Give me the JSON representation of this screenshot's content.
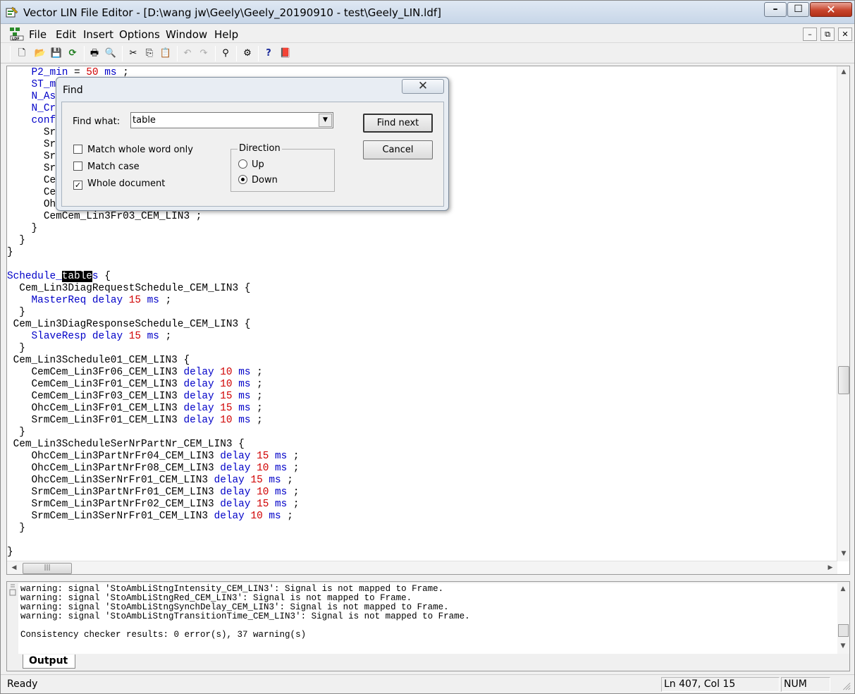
{
  "window": {
    "title": "Vector LIN File Editor - [D:\\wang jw\\Geely\\Geely_20190910 - test\\Geely_LIN.ldf]",
    "min": "–",
    "max": "☐",
    "close": "✕"
  },
  "menu": {
    "file": "File",
    "edit": "Edit",
    "insert": "Insert",
    "options": "Options",
    "window": "Window",
    "help": "Help",
    "mdi_min": "–",
    "mdi_restore": "⧉",
    "mdi_close": "✕"
  },
  "toolbar": {
    "new": "🗋",
    "open": "📂",
    "save": "💾",
    "refresh": "⟳",
    "print": "🖶",
    "preview": "🔍",
    "cut": "✂",
    "copy": "⎘",
    "paste": "📋",
    "undo": "↶",
    "redo": "↷",
    "find": "⚲",
    "check": "⚙",
    "help": "?",
    "book": "📕"
  },
  "editor": {
    "lines": [
      {
        "segs": [
          {
            "t": "    "
          },
          {
            "t": "P2_min",
            "c": "b"
          },
          {
            "t": " = "
          },
          {
            "t": "50",
            "c": "r"
          },
          {
            "t": " "
          },
          {
            "t": "ms",
            "c": "b"
          },
          {
            "t": " ;"
          }
        ]
      },
      {
        "segs": [
          {
            "t": "    "
          },
          {
            "t": "ST_m",
            "c": "b"
          }
        ]
      },
      {
        "segs": [
          {
            "t": "    "
          },
          {
            "t": "N_As",
            "c": "b"
          }
        ]
      },
      {
        "segs": [
          {
            "t": "    "
          },
          {
            "t": "N_Cr",
            "c": "b"
          }
        ]
      },
      {
        "segs": [
          {
            "t": "    "
          },
          {
            "t": "conf",
            "c": "b"
          }
        ]
      },
      {
        "segs": [
          {
            "t": "      Sr"
          }
        ]
      },
      {
        "segs": [
          {
            "t": "      Sr"
          }
        ]
      },
      {
        "segs": [
          {
            "t": "      Sr"
          }
        ]
      },
      {
        "segs": [
          {
            "t": "      Sr"
          }
        ]
      },
      {
        "segs": [
          {
            "t": "      Ce"
          }
        ]
      },
      {
        "segs": [
          {
            "t": "      Ce"
          }
        ]
      },
      {
        "segs": [
          {
            "t": "      Oh"
          }
        ]
      },
      {
        "segs": [
          {
            "t": "      CemCem_Lin3Fr03_CEM_LIN3 ;"
          }
        ]
      },
      {
        "segs": [
          {
            "t": "    }"
          }
        ]
      },
      {
        "segs": [
          {
            "t": "  }"
          }
        ]
      },
      {
        "segs": [
          {
            "t": "}"
          }
        ]
      },
      {
        "segs": [
          {
            "t": ""
          }
        ]
      },
      {
        "segs": [
          {
            "t": "Schedule_",
            "c": "b"
          },
          {
            "t": "table",
            "c": "hl"
          },
          {
            "t": "s",
            "c": "b"
          },
          {
            "t": " {"
          }
        ]
      },
      {
        "segs": [
          {
            "t": "  Cem_Lin3DiagRequestSchedule_CEM_LIN3 {"
          }
        ]
      },
      {
        "segs": [
          {
            "t": "    "
          },
          {
            "t": "MasterReq",
            "c": "b"
          },
          {
            "t": " "
          },
          {
            "t": "delay",
            "c": "b"
          },
          {
            "t": " "
          },
          {
            "t": "15",
            "c": "r"
          },
          {
            "t": " "
          },
          {
            "t": "ms",
            "c": "b"
          },
          {
            "t": " ;"
          }
        ]
      },
      {
        "segs": [
          {
            "t": "  }"
          }
        ]
      },
      {
        "segs": [
          {
            "t": " Cem_Lin3DiagResponseSchedule_CEM_LIN3 {"
          }
        ]
      },
      {
        "segs": [
          {
            "t": "    "
          },
          {
            "t": "SlaveResp",
            "c": "b"
          },
          {
            "t": " "
          },
          {
            "t": "delay",
            "c": "b"
          },
          {
            "t": " "
          },
          {
            "t": "15",
            "c": "r"
          },
          {
            "t": " "
          },
          {
            "t": "ms",
            "c": "b"
          },
          {
            "t": " ;"
          }
        ]
      },
      {
        "segs": [
          {
            "t": "  }"
          }
        ]
      },
      {
        "segs": [
          {
            "t": " Cem_Lin3Schedule01_CEM_LIN3 {"
          }
        ]
      },
      {
        "segs": [
          {
            "t": "    CemCem_Lin3Fr06_CEM_LIN3 "
          },
          {
            "t": "delay",
            "c": "b"
          },
          {
            "t": " "
          },
          {
            "t": "10",
            "c": "r"
          },
          {
            "t": " "
          },
          {
            "t": "ms",
            "c": "b"
          },
          {
            "t": " ;"
          }
        ]
      },
      {
        "segs": [
          {
            "t": "    CemCem_Lin3Fr01_CEM_LIN3 "
          },
          {
            "t": "delay",
            "c": "b"
          },
          {
            "t": " "
          },
          {
            "t": "10",
            "c": "r"
          },
          {
            "t": " "
          },
          {
            "t": "ms",
            "c": "b"
          },
          {
            "t": " ;"
          }
        ]
      },
      {
        "segs": [
          {
            "t": "    CemCem_Lin3Fr03_CEM_LIN3 "
          },
          {
            "t": "delay",
            "c": "b"
          },
          {
            "t": " "
          },
          {
            "t": "15",
            "c": "r"
          },
          {
            "t": " "
          },
          {
            "t": "ms",
            "c": "b"
          },
          {
            "t": " ;"
          }
        ]
      },
      {
        "segs": [
          {
            "t": "    OhcCem_Lin3Fr01_CEM_LIN3 "
          },
          {
            "t": "delay",
            "c": "b"
          },
          {
            "t": " "
          },
          {
            "t": "15",
            "c": "r"
          },
          {
            "t": " "
          },
          {
            "t": "ms",
            "c": "b"
          },
          {
            "t": " ;"
          }
        ]
      },
      {
        "segs": [
          {
            "t": "    SrmCem_Lin3Fr01_CEM_LIN3 "
          },
          {
            "t": "delay",
            "c": "b"
          },
          {
            "t": " "
          },
          {
            "t": "10",
            "c": "r"
          },
          {
            "t": " "
          },
          {
            "t": "ms",
            "c": "b"
          },
          {
            "t": " ;"
          }
        ]
      },
      {
        "segs": [
          {
            "t": "  }"
          }
        ]
      },
      {
        "segs": [
          {
            "t": " Cem_Lin3ScheduleSerNrPartNr_CEM_LIN3 {"
          }
        ]
      },
      {
        "segs": [
          {
            "t": "    OhcCem_Lin3PartNrFr04_CEM_LIN3 "
          },
          {
            "t": "delay",
            "c": "b"
          },
          {
            "t": " "
          },
          {
            "t": "15",
            "c": "r"
          },
          {
            "t": " "
          },
          {
            "t": "ms",
            "c": "b"
          },
          {
            "t": " ;"
          }
        ]
      },
      {
        "segs": [
          {
            "t": "    OhcCem_Lin3PartNrFr08_CEM_LIN3 "
          },
          {
            "t": "delay",
            "c": "b"
          },
          {
            "t": " "
          },
          {
            "t": "10",
            "c": "r"
          },
          {
            "t": " "
          },
          {
            "t": "ms",
            "c": "b"
          },
          {
            "t": " ;"
          }
        ]
      },
      {
        "segs": [
          {
            "t": "    OhcCem_Lin3SerNrFr01_CEM_LIN3 "
          },
          {
            "t": "delay",
            "c": "b"
          },
          {
            "t": " "
          },
          {
            "t": "15",
            "c": "r"
          },
          {
            "t": " "
          },
          {
            "t": "ms",
            "c": "b"
          },
          {
            "t": " ;"
          }
        ]
      },
      {
        "segs": [
          {
            "t": "    SrmCem_Lin3PartNrFr01_CEM_LIN3 "
          },
          {
            "t": "delay",
            "c": "b"
          },
          {
            "t": " "
          },
          {
            "t": "10",
            "c": "r"
          },
          {
            "t": " "
          },
          {
            "t": "ms",
            "c": "b"
          },
          {
            "t": " ;"
          }
        ]
      },
      {
        "segs": [
          {
            "t": "    SrmCem_Lin3PartNrFr02_CEM_LIN3 "
          },
          {
            "t": "delay",
            "c": "b"
          },
          {
            "t": " "
          },
          {
            "t": "15",
            "c": "r"
          },
          {
            "t": " "
          },
          {
            "t": "ms",
            "c": "b"
          },
          {
            "t": " ;"
          }
        ]
      },
      {
        "segs": [
          {
            "t": "    SrmCem_Lin3SerNrFr01_CEM_LIN3 "
          },
          {
            "t": "delay",
            "c": "b"
          },
          {
            "t": " "
          },
          {
            "t": "10",
            "c": "r"
          },
          {
            "t": " "
          },
          {
            "t": "ms",
            "c": "b"
          },
          {
            "t": " ;"
          }
        ]
      },
      {
        "segs": [
          {
            "t": "  }"
          }
        ]
      },
      {
        "segs": [
          {
            "t": ""
          }
        ]
      },
      {
        "segs": [
          {
            "t": "}"
          }
        ]
      }
    ],
    "hscroll_grip": "|||",
    "arrow_up": "▲",
    "arrow_down": "▼",
    "arrow_left": "◀",
    "arrow_right": "▶"
  },
  "output": {
    "lines": [
      "warning: signal 'StoAmbLiStngIntensity_CEM_LIN3': Signal is not mapped to Frame.",
      "warning: signal 'StoAmbLiStngRed_CEM_LIN3': Signal is not mapped to Frame.",
      "warning: signal 'StoAmbLiStngSynchDelay_CEM_LIN3': Signal is not mapped to Frame.",
      "warning: signal 'StoAmbLiStngTransitionTime_CEM_LIN3': Signal is not mapped to Frame.",
      "",
      "Consistency checker results: 0 error(s), 37 warning(s)"
    ],
    "tab_label": "Output"
  },
  "status": {
    "ready": "Ready",
    "position": "Ln 407, Col 15",
    "num": "NUM"
  },
  "find_dialog": {
    "title": "Find",
    "close": "✕",
    "find_what_label": "Find what:",
    "find_what_value": "table",
    "combo_arrow": "▼",
    "match_whole_word": "Match whole word only",
    "match_case": "Match case",
    "whole_document": "Whole document",
    "whole_document_mark": "✓",
    "direction_label": "Direction",
    "up": "Up",
    "down": "Down",
    "find_next": "Find next",
    "cancel": "Cancel"
  }
}
